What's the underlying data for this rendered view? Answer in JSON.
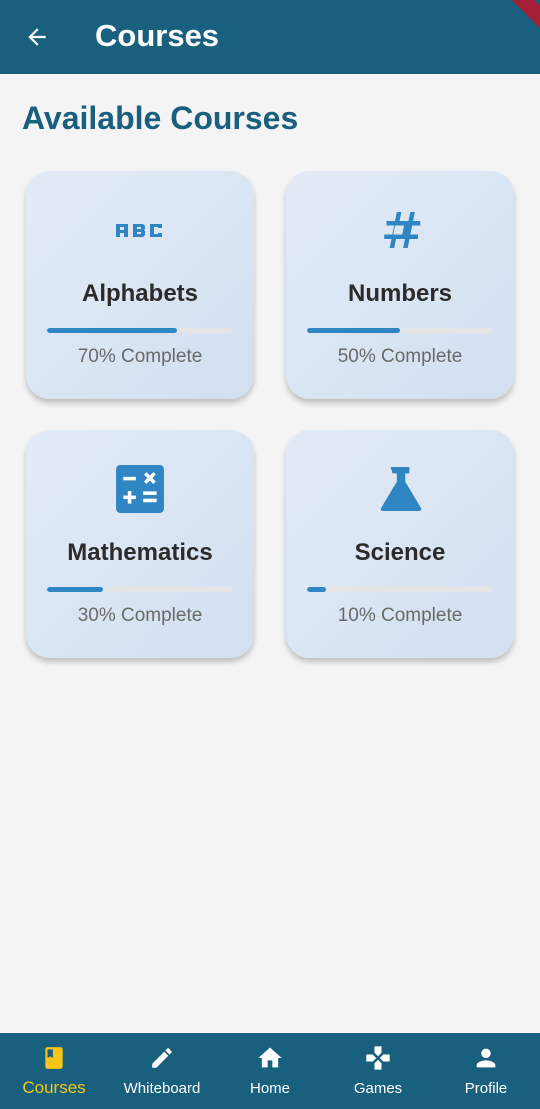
{
  "app_bar": {
    "title": "Courses",
    "back_icon": "arrow-left-icon"
  },
  "section_title": "Available Courses",
  "colors": {
    "app_bar": "#19607f",
    "accent": "#2f86c3",
    "active_nav": "#f5c518"
  },
  "courses": [
    {
      "title": "Alphabets",
      "icon": "abc-icon",
      "progress_percent": 70,
      "status": "70% Complete"
    },
    {
      "title": "Numbers",
      "icon": "hashtag-icon",
      "progress_percent": 50,
      "status": "50% Complete"
    },
    {
      "title": "Mathematics",
      "icon": "calculator-icon",
      "progress_percent": 30,
      "status": "30% Complete"
    },
    {
      "title": "Science",
      "icon": "flask-icon",
      "progress_percent": 10,
      "status": "10% Complete"
    }
  ],
  "bottom_nav": {
    "items": [
      {
        "label": "Courses",
        "icon": "book-icon",
        "active": true
      },
      {
        "label": "Whiteboard",
        "icon": "pencil-icon",
        "active": false
      },
      {
        "label": "Home",
        "icon": "home-icon",
        "active": false
      },
      {
        "label": "Games",
        "icon": "gamepad-icon",
        "active": false
      },
      {
        "label": "Profile",
        "icon": "person-icon",
        "active": false
      }
    ]
  }
}
